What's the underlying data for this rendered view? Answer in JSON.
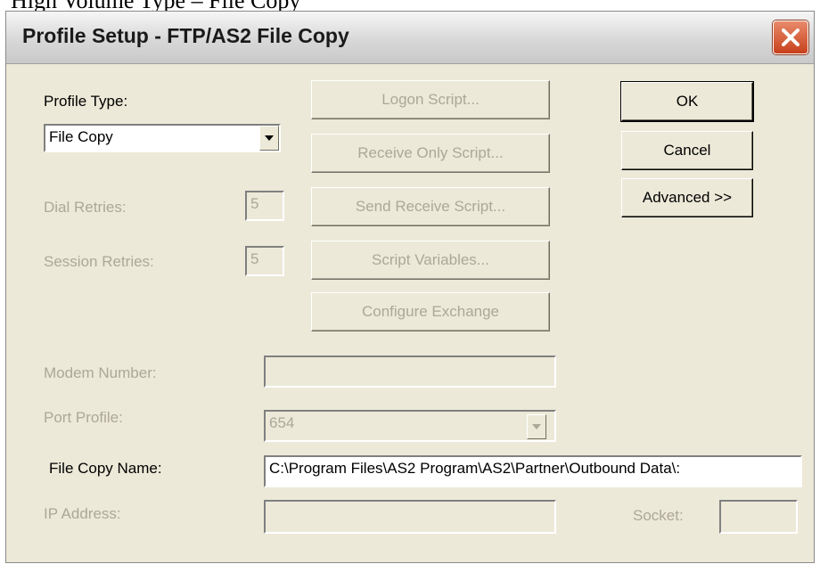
{
  "background_caption": "High Volume Type – File Copy",
  "window": {
    "title": "Profile Setup - FTP/AS2 File Copy"
  },
  "profile_type": {
    "label": "Profile Type:",
    "value": "File Copy"
  },
  "dial_retries": {
    "label": "Dial Retries:",
    "value": "5"
  },
  "session_retries": {
    "label": "Session Retries:",
    "value": "5"
  },
  "script_buttons": {
    "logon": "Logon Script...",
    "receive_only": "Receive Only Script...",
    "send_receive": "Send Receive Script...",
    "variables": "Script Variables...",
    "configure_exchange": "Configure Exchange"
  },
  "actions": {
    "ok": "OK",
    "cancel": "Cancel",
    "advanced": "Advanced >>"
  },
  "modem_number": {
    "label": "Modem Number:",
    "value": ""
  },
  "port_profile": {
    "label": "Port Profile:",
    "value": "654"
  },
  "file_copy_name": {
    "label": "File Copy Name:",
    "value": "C:\\Program Files\\AS2 Program\\AS2\\Partner\\Outbound Data\\:"
  },
  "ip_address": {
    "label": "IP Address:",
    "value": ""
  },
  "socket": {
    "label": "Socket:",
    "value": ""
  },
  "colors": {
    "disabled_text": "#aca899",
    "dialog_bg": "#ece9d8",
    "close_red": "#c8401c"
  }
}
